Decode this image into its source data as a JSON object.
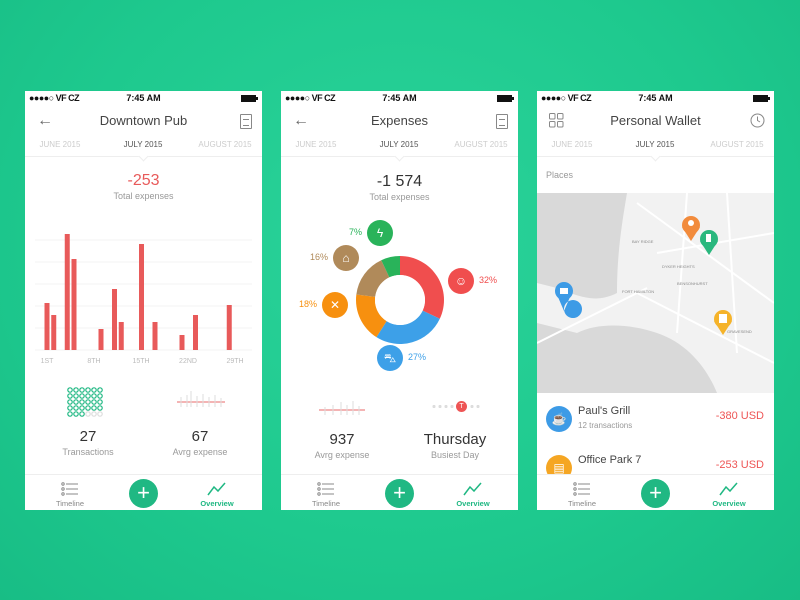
{
  "status": {
    "carrier": "●●●●○ VF CZ",
    "time": "7:45 AM"
  },
  "months": [
    "JUNE 2015",
    "JULY 2015",
    "AUGUST 2015"
  ],
  "nav": {
    "timeline": "Timeline",
    "add": "+",
    "overview": "Overview"
  },
  "screen1": {
    "title": "Downtown Pub",
    "total": "-253",
    "total_label": "Total expenses",
    "stats": [
      {
        "value": "27",
        "label": "Transactions"
      },
      {
        "value": "67",
        "label": "Avrg expense"
      }
    ],
    "chart_data": {
      "type": "bar",
      "x_ticks": [
        "1ST",
        "8TH",
        "15TH",
        "22ND",
        "29TH"
      ],
      "days": [
        1,
        2,
        4,
        5,
        9,
        11,
        12,
        15,
        17,
        21,
        23,
        28
      ],
      "values": [
        47,
        35,
        116,
        91,
        21,
        61,
        28,
        106,
        28,
        15,
        35,
        45
      ],
      "color": "#e85a5a",
      "grid": true
    }
  },
  "screen2": {
    "title": "Expenses",
    "total": "-1 574",
    "total_label": "Total expenses",
    "chart_data": {
      "type": "pie",
      "donut": true,
      "slices": [
        {
          "icon": "user-icon",
          "value": 32,
          "label": "32%",
          "color": "#f04e4e"
        },
        {
          "icon": "car-icon",
          "value": 27,
          "label": "27%",
          "color": "#3da0e8"
        },
        {
          "icon": "food-icon",
          "value": 18,
          "label": "18%",
          "color": "#f7900f"
        },
        {
          "icon": "home-icon",
          "value": 16,
          "label": "16%",
          "color": "#b08a5a"
        },
        {
          "icon": "energy-icon",
          "value": 7,
          "label": "7%",
          "color": "#29b35a"
        }
      ]
    },
    "stats": [
      {
        "value": "937",
        "label": "Avrg expense"
      },
      {
        "value": "Thursday",
        "label": "Busiest Day"
      }
    ],
    "busiest_marker": "T"
  },
  "screen3": {
    "title": "Personal Wallet",
    "section": "Places",
    "map_labels": [
      "BAY RIDGE",
      "DYKER HEIGHTS",
      "FORT HAMILTON",
      "BENSONHURST",
      "GRAVESEND"
    ],
    "places": [
      {
        "name": "Paul's Grill",
        "sub": "12 transactions",
        "amount": "-380 USD",
        "color": "#3d9be6"
      },
      {
        "name": "Office Park 7",
        "sub": "",
        "amount": "-253 USD",
        "color": "#f5a623"
      }
    ]
  },
  "colors": {
    "accent": "#20b883",
    "negative": "#ee5555",
    "background": "#1ec98e"
  }
}
